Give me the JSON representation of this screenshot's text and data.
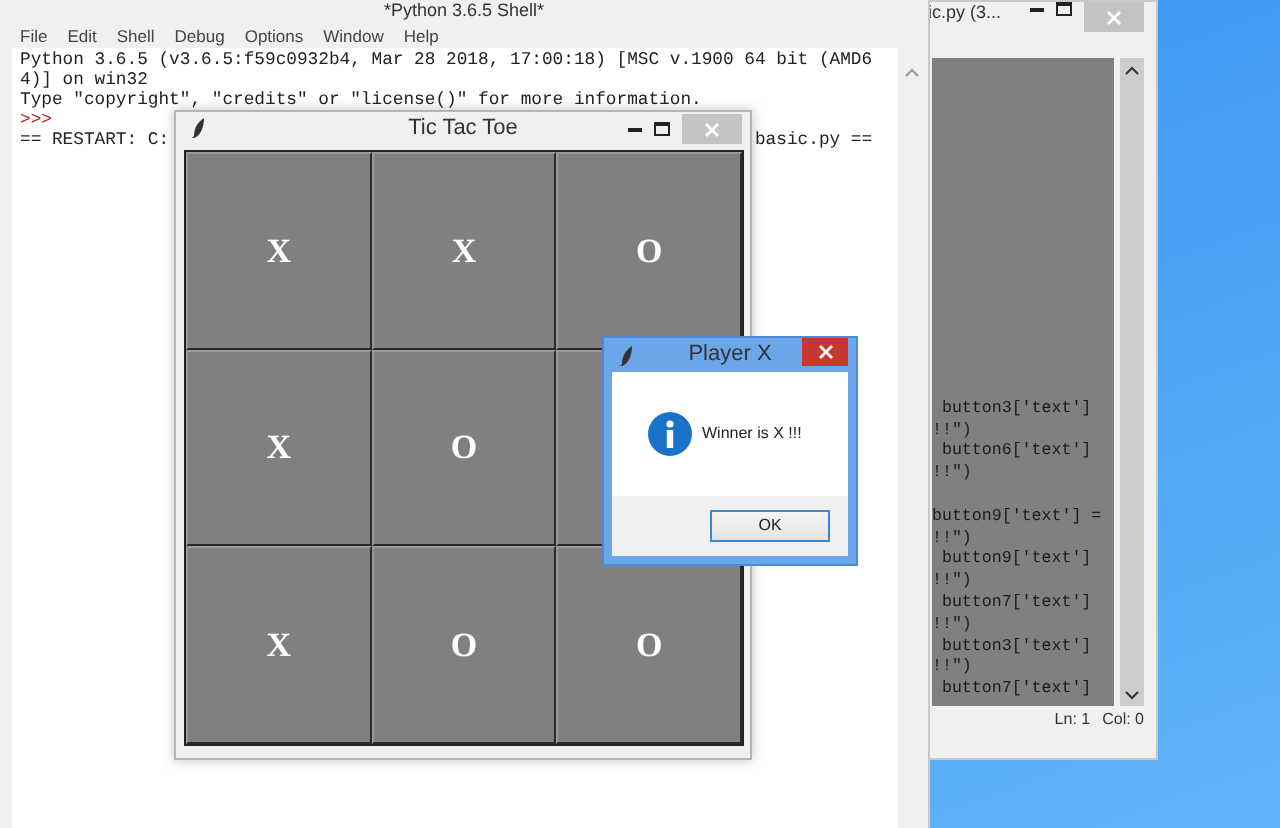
{
  "shell_window": {
    "title": "*Python 3.6.5 Shell*",
    "menu": [
      "File",
      "Edit",
      "Shell",
      "Debug",
      "Options",
      "Window",
      "Help"
    ],
    "lines": [
      "Python 3.6.5 (v3.6.5:f59c0932b4, Mar 28 2018, 17:00:18) [MSC v.1900 64 bit (AMD6",
      "4)] on win32",
      "Type \"copyright\", \"credits\" or \"license()\" for more information."
    ],
    "prompt": ">>>",
    "restart_start": "== RESTART: C:",
    "restart_end": "basic.py =="
  },
  "editor_window": {
    "title": "ic.py (3...",
    "code_lines": [
      " button3['text']",
      "!!\")",
      " button6['text']",
      "!!\")",
      "button9['text'] =",
      "!!\")",
      " button9['text']",
      "!!\")",
      " button7['text']",
      "!!\")",
      " button3['text']",
      "!!\")",
      " button7['text']"
    ],
    "status": [
      "Ln: 1",
      "Col: 0"
    ]
  },
  "game_window": {
    "title": "Tic Tac Toe",
    "cells": [
      {
        "mark": "X"
      },
      {
        "mark": "X"
      },
      {
        "mark": "O"
      },
      {
        "mark": "X"
      },
      {
        "mark": "O"
      },
      {},
      {
        "mark": "X"
      },
      {
        "mark": "O"
      },
      {
        "mark": "O"
      }
    ]
  },
  "dialog": {
    "title": "Player X",
    "message": "Winner is X !!!",
    "buttons": [
      "OK"
    ]
  }
}
